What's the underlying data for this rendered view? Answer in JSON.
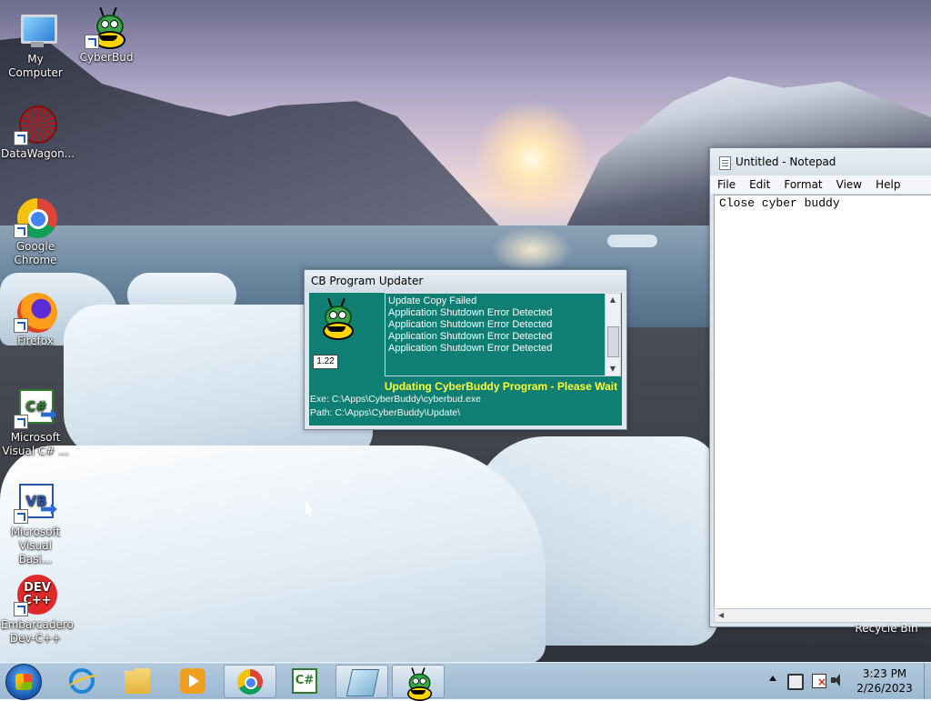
{
  "desktop": {
    "icons": [
      {
        "label": "My Computer",
        "icon": "computer-icon"
      },
      {
        "label": "CyberBud",
        "icon": "cyberbud-icon"
      },
      {
        "label": "DataWagon...",
        "icon": "datawagon-icon"
      },
      {
        "label": "Google Chrome",
        "icon": "chrome-icon"
      },
      {
        "label": "Firefox",
        "icon": "firefox-icon"
      },
      {
        "label": "Microsoft Visual C# ...",
        "icon": "visual-csharp-icon"
      },
      {
        "label": "Microsoft Visual Basi...",
        "icon": "visual-basic-icon"
      },
      {
        "label": "Embarcadero Dev-C++",
        "icon": "devcpp-icon"
      }
    ],
    "recycle_bin_label": "Recycle Bin"
  },
  "cb_updater": {
    "title": "CB Program Updater",
    "version": "1.22",
    "log": [
      "Update Copy Failed",
      "Application Shutdown Error Detected",
      "Application Shutdown Error Detected",
      "Application Shutdown Error Detected",
      "Application Shutdown Error Detected"
    ],
    "status": "Updating CyberBuddy Program - Please Wait",
    "exe": "Exe: C:\\Apps\\CyberBuddy\\cyberbud.exe",
    "path": "Path: C:\\Apps\\CyberBuddy\\Update\\"
  },
  "notepad": {
    "title": "Untitled - Notepad",
    "menu": [
      "File",
      "Edit",
      "Format",
      "View",
      "Help"
    ],
    "text": "Close cyber buddy"
  },
  "taskbar": {
    "items": [
      {
        "name": "internet-explorer",
        "icon": "ie-icon",
        "active": false
      },
      {
        "name": "file-explorer",
        "icon": "folder-icon",
        "active": false
      },
      {
        "name": "media-player",
        "icon": "media-player-icon",
        "active": false
      },
      {
        "name": "google-chrome",
        "icon": "chrome-icon",
        "active": true
      },
      {
        "name": "visual-csharp",
        "icon": "visual-csharp-icon",
        "active": false
      },
      {
        "name": "notepad",
        "icon": "notepad-icon",
        "active": true
      },
      {
        "name": "cyberbud",
        "icon": "cyberbud-icon",
        "active": true
      }
    ],
    "clock_time": "3:23 PM",
    "clock_date": "2/26/2023"
  },
  "colors": {
    "updater_bg": "#0f7f73",
    "updater_status": "#ffff33",
    "taskbar": "#a9c6de"
  }
}
